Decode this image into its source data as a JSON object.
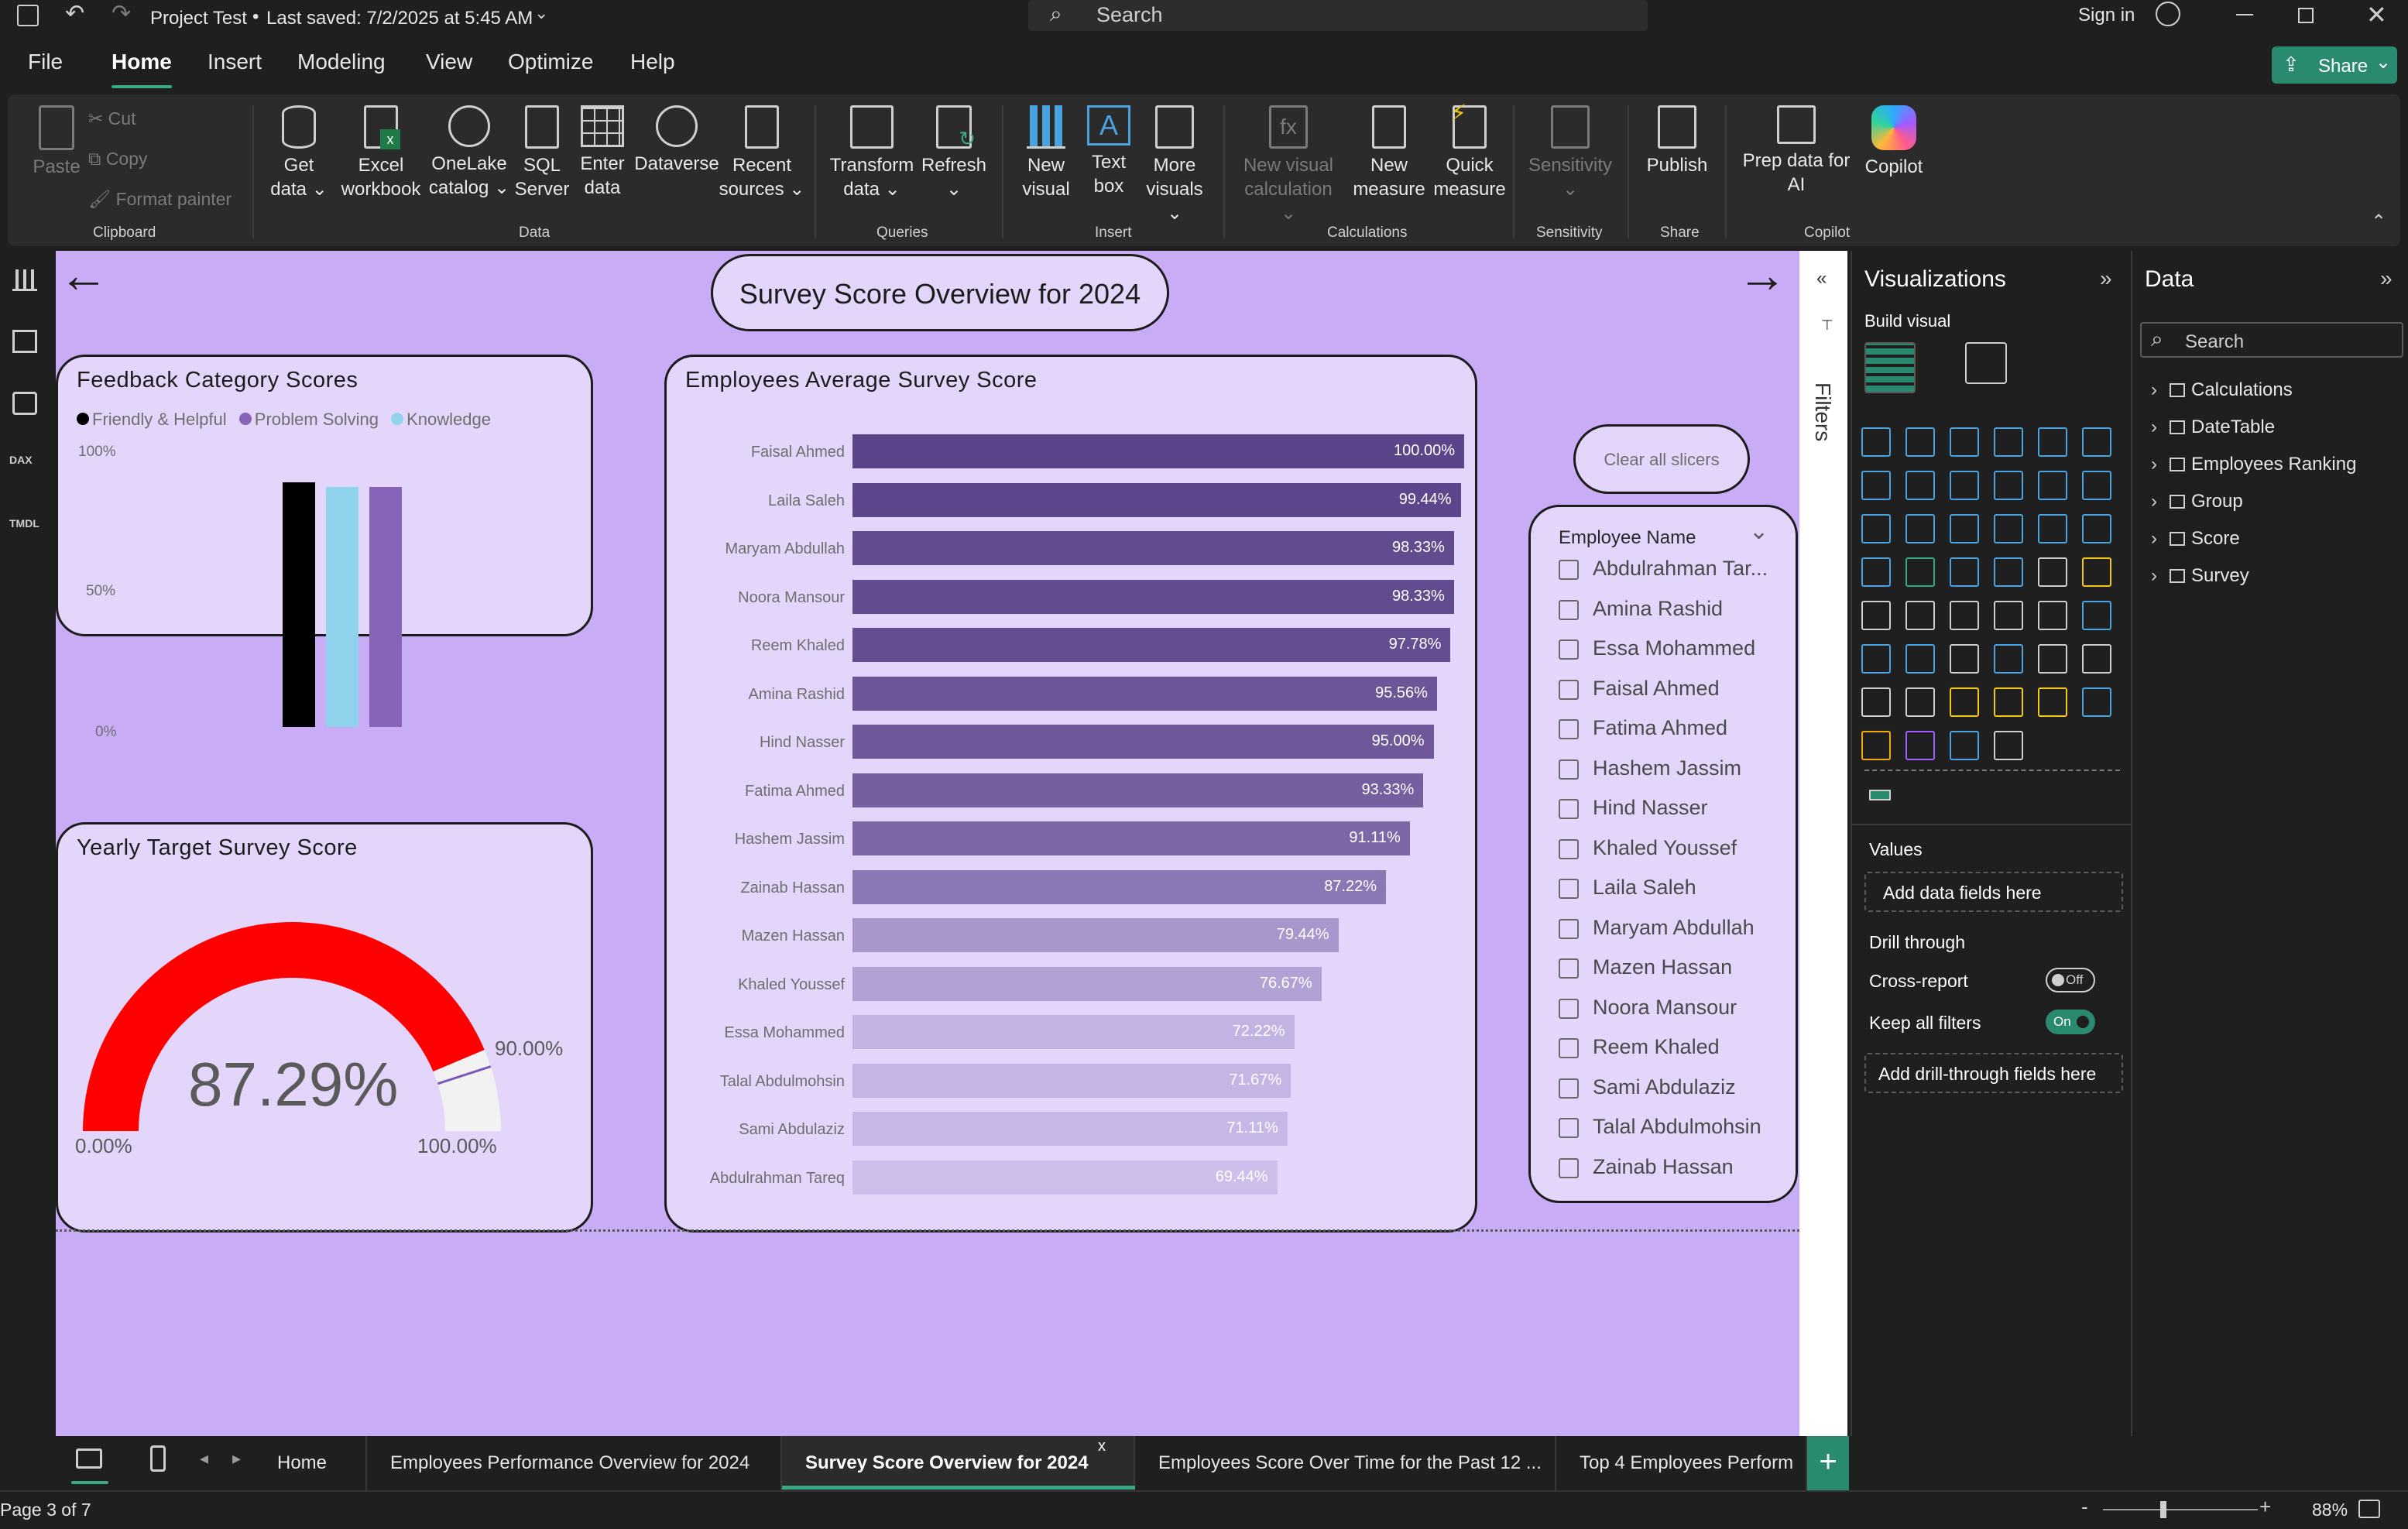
{
  "titlebar": {
    "doc_title": "Project Test",
    "saved": "Last saved: 7/2/2025 at 5:45 AM",
    "search": "Search",
    "signin": "Sign in"
  },
  "menu": {
    "file": "File",
    "home": "Home",
    "insert": "Insert",
    "modeling": "Modeling",
    "view": "View",
    "optimize": "Optimize",
    "help": "Help",
    "share": "Share"
  },
  "ribbon": {
    "clipboard": {
      "paste": "Paste",
      "cut": "Cut",
      "copy": "Copy",
      "format_painter": "Format painter",
      "group": "Clipboard"
    },
    "data": {
      "get_data_1": "Get",
      "get_data_2": "data",
      "excel_1": "Excel",
      "excel_2": "workbook",
      "onelake_1": "OneLake",
      "onelake_2": "catalog",
      "sql_1": "SQL",
      "sql_2": "Server",
      "enter_1": "Enter",
      "enter_2": "data",
      "dataverse": "Dataverse",
      "recent_1": "Recent",
      "recent_2": "sources",
      "group": "Data"
    },
    "queries": {
      "transform_1": "Transform",
      "transform_2": "data",
      "refresh": "Refresh",
      "group": "Queries"
    },
    "insert": {
      "newvisual_1": "New",
      "newvisual_2": "visual",
      "textbox_1": "Text",
      "textbox_2": "box",
      "more_1": "More",
      "more_2": "visuals",
      "group": "Insert"
    },
    "calculations": {
      "newcalc_1": "New visual",
      "newcalc_2": "calculation",
      "newmeasure_1": "New",
      "newmeasure_2": "measure",
      "quick_1": "Quick",
      "quick_2": "measure",
      "group": "Calculations"
    },
    "sensitivity": {
      "label": "Sensitivity",
      "group": "Sensitivity"
    },
    "share": {
      "publish": "Publish",
      "group": "Share"
    },
    "copilot": {
      "prep_1": "Prep data for",
      "prep_2": "AI",
      "copilot": "Copilot",
      "group": "Copilot"
    }
  },
  "report": {
    "page_title": "Survey Score Overview for 2024",
    "feedback": {
      "title": "Feedback Category Scores",
      "legend": [
        "Friendly & Helpful",
        "Problem Solving",
        "Knowledge"
      ],
      "ticks": [
        "100%",
        "50%",
        "0%"
      ]
    },
    "employees": {
      "title": "Employees Average Survey Score"
    },
    "gauge": {
      "title": "Yearly Target Survey Score",
      "value": "87.29%",
      "min": "0.00%",
      "max": "100.00%",
      "target": "90.00%"
    },
    "clear_slicers": "Clear all slicers",
    "slicer": {
      "title": "Employee Name",
      "items": [
        "Abdulrahman Tar...",
        "Amina Rashid",
        "Essa Mohammed",
        "Faisal Ahmed",
        "Fatima Ahmed",
        "Hashem Jassim",
        "Hind Nasser",
        "Khaled Youssef",
        "Laila Saleh",
        "Maryam Abdullah",
        "Mazen Hassan",
        "Noora Mansour",
        "Reem Khaled",
        "Sami Abdulaziz",
        "Talal Abdulmohsin",
        "Zainab Hassan"
      ]
    }
  },
  "chart_data": [
    {
      "type": "bar",
      "title": "Employees Average Survey Score",
      "orientation": "horizontal",
      "categories": [
        "Faisal Ahmed",
        "Laila Saleh",
        "Maryam Abdullah",
        "Noora Mansour",
        "Reem Khaled",
        "Amina Rashid",
        "Hind Nasser",
        "Fatima Ahmed",
        "Hashem Jassim",
        "Zainab Hassan",
        "Mazen Hassan",
        "Khaled Youssef",
        "Essa Mohammed",
        "Talal Abdulmohsin",
        "Sami Abdulaziz",
        "Abdulrahman Tareq"
      ],
      "values": [
        100.0,
        99.44,
        98.33,
        98.33,
        97.78,
        95.56,
        95.0,
        93.33,
        91.11,
        87.22,
        79.44,
        76.67,
        72.22,
        71.67,
        71.11,
        69.44
      ],
      "labels": [
        "100.00%",
        "99.44%",
        "98.33%",
        "98.33%",
        "97.78%",
        "95.56%",
        "95.00%",
        "93.33%",
        "91.11%",
        "87.22%",
        "79.44%",
        "76.67%",
        "72.22%",
        "71.67%",
        "71.11%",
        "69.44%"
      ],
      "xlim": [
        0,
        100
      ]
    },
    {
      "type": "bar",
      "title": "Feedback Category Scores",
      "series": [
        {
          "name": "Friendly & Helpful",
          "values": [
            100
          ],
          "color": "#000000"
        },
        {
          "name": "Problem Solving",
          "values": [
            98
          ],
          "color": "#8fd4ec"
        },
        {
          "name": "Knowledge",
          "values": [
            98
          ],
          "color": "#8764b8"
        }
      ],
      "ylim": [
        0,
        100
      ],
      "grid": false
    }
  ],
  "filters": {
    "label": "Filters"
  },
  "viz": {
    "title": "Visualizations",
    "build": "Build visual",
    "values": "Values",
    "add_fields": "Add data fields here",
    "drill": "Drill through",
    "cross": "Cross-report",
    "cross_state": "Off",
    "keep": "Keep all filters",
    "keep_state": "On",
    "add_drill": "Add drill-through fields here"
  },
  "data_pane": {
    "title": "Data",
    "search": "Search",
    "items": [
      "Calculations",
      "DateTable",
      "Employees Ranking",
      "Group",
      "Score",
      "Survey"
    ]
  },
  "tabs": [
    "Home",
    "Employees Performance Overview for 2024",
    "Survey Score Overview for 2024",
    "Employees Score Over Time for the Past 12 ...",
    "Top 4 Employees Perform"
  ],
  "status": {
    "page": "Page 3 of 7",
    "zoom": "88%"
  },
  "colors": {
    "canvas": "#c8acf6",
    "card": "#e4d5fb",
    "accent": "#2a8a70",
    "gauge_fill": "#ff0000"
  }
}
